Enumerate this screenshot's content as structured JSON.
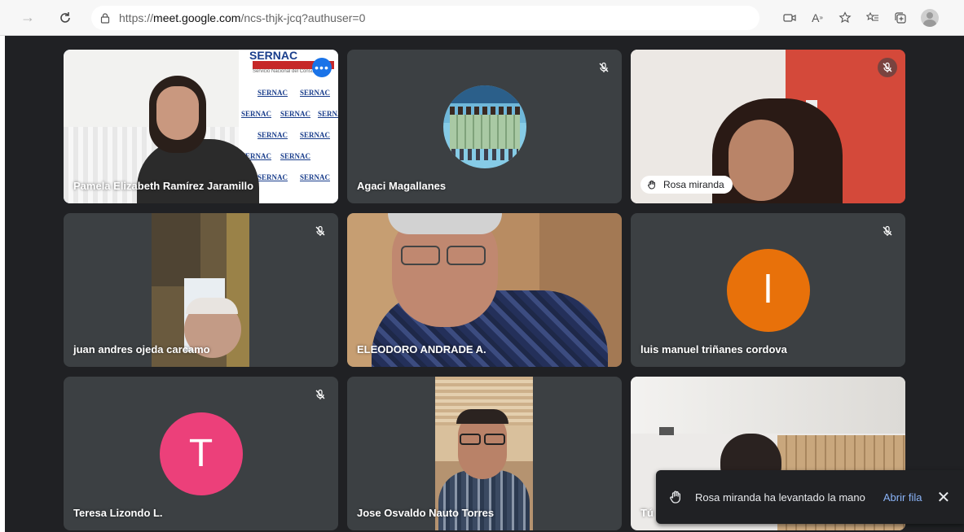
{
  "browser": {
    "url_scheme": "https://",
    "url_host": "meet.google.com",
    "url_path": "/ncs-thjk-jcq?authuser=0"
  },
  "tiles": [
    {
      "name": "Pamela Elizabeth Ramírez Jaramillo",
      "type": "video",
      "active": true
    },
    {
      "name": "Agaci Magallanes",
      "type": "avatar-photo",
      "muted": true
    },
    {
      "name": "Rosa miranda",
      "type": "video",
      "muted": true,
      "hand_raised": true
    },
    {
      "name": "juan andres ojeda carcamo",
      "type": "video",
      "muted": true
    },
    {
      "name": "ELEODORO ANDRADE A.",
      "type": "video"
    },
    {
      "name": "luis manuel triñanes cordova",
      "type": "initial",
      "initial": "l",
      "color": "#e8710a",
      "muted": true
    },
    {
      "name": "Teresa Lizondo L.",
      "type": "initial",
      "initial": "T",
      "color": "#ec407a",
      "muted": true
    },
    {
      "name": "Jose Osvaldo Nauto Torres",
      "type": "video"
    },
    {
      "name": "Tú",
      "type": "video"
    }
  ],
  "sernac": {
    "word": "SERNAC",
    "top_banner": "SERNAC",
    "subtitle": "Servicio Nacional del Consumidor"
  },
  "toast": {
    "message": "Rosa miranda ha levantado la mano",
    "action": "Abrir fila",
    "close": "✕"
  },
  "colors": {
    "accent_blue": "#1a73e8",
    "link_blue": "#8ab4f8",
    "tile_bg": "#3c4043",
    "page_bg": "#202124"
  }
}
